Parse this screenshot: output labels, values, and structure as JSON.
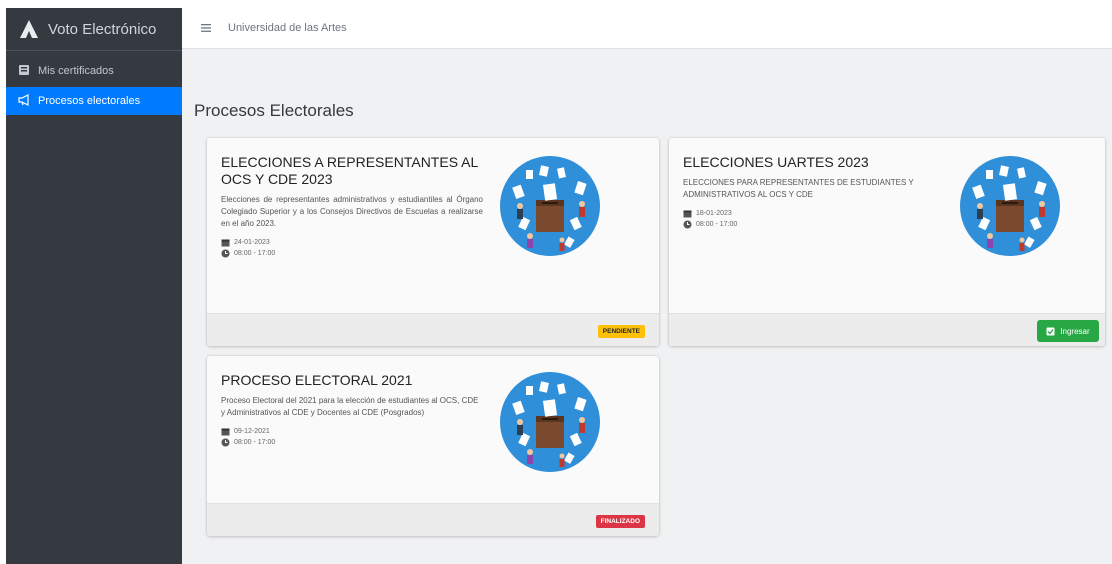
{
  "app": {
    "brand": "Voto Electrónico"
  },
  "sidebar": {
    "items": [
      {
        "label": "Mis certificados",
        "icon": "certificate-icon",
        "active": false
      },
      {
        "label": "Procesos electorales",
        "icon": "megaphone-icon",
        "active": true
      }
    ]
  },
  "navbar": {
    "menu_icon": "hamburger-icon",
    "institution": "Universidad de las Artes"
  },
  "page": {
    "title": "Procesos Electorales"
  },
  "cards": [
    {
      "title": "ELECCIONES A REPRESENTANTES AL OCS Y CDE 2023",
      "description": "Elecciones de representantes administrativos y estudiantiles al Órgano Colegiado Superior y a los Consejos Directivos de Escuelas a realizarse en el año 2023.",
      "date": "24-01-2023",
      "time": "08:00 - 17:00",
      "status": "PENDIENTE",
      "status_color": "#ffc107"
    },
    {
      "title": "ELECCIONES UARTES 2023",
      "description": "ELECCIONES PARA REPRESENTANTES DE ESTUDIANTES Y ADMINISTRATIVOS AL OCS Y CDE",
      "date": "18-01-2023",
      "time": "08:00 - 17:00",
      "action_label": "Ingresar",
      "action_color": "#28a745"
    },
    {
      "title": "PROCESO ELECTORAL 2021",
      "description": "Proceso Electoral del 2021 para la elección de estudiantes al OCS, CDE y Administrativos al CDE y Docentes al CDE (Posgrados)",
      "date": "09-12-2021",
      "time": "08:00 - 17:00",
      "status": "FINALIZADO",
      "status_color": "#dc3545"
    }
  ],
  "colors": {
    "sidebar_bg": "#343a40",
    "active_item": "#007bff",
    "illustration_bg": "#2f8fd8",
    "ballot_box": "#7b4a2e"
  }
}
